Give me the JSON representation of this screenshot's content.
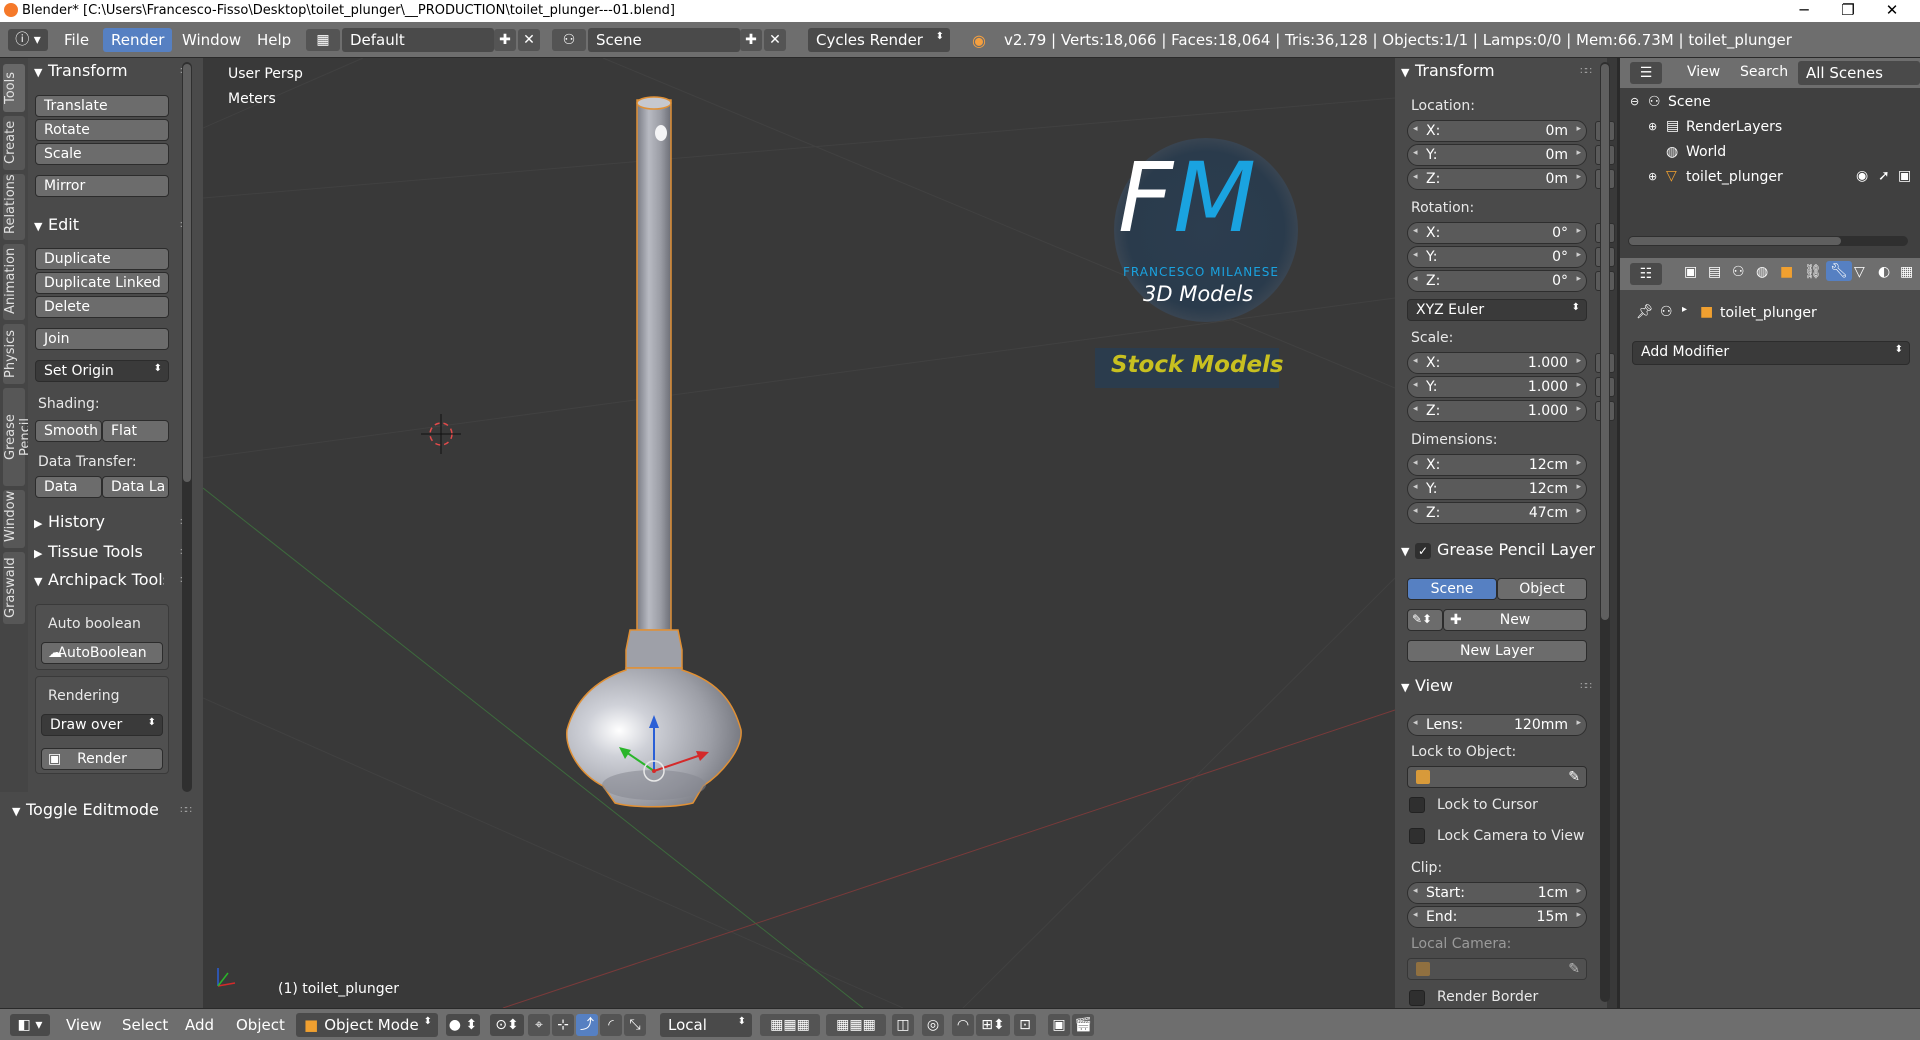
{
  "window": {
    "title": "Blender* [C:\\Users\\Francesco-Fisso\\Desktop\\toilet_plunger\\__PRODUCTION\\toilet_plunger---01.blend]",
    "controls": {
      "minimize": "─",
      "restore": "❐",
      "close": "✕"
    }
  },
  "topbar": {
    "menus": [
      "File",
      "Render",
      "Window",
      "Help"
    ],
    "active_menu": "Render",
    "layout": "Default",
    "scene": "Scene",
    "engine": "Cycles Render",
    "stats": "v2.79 | Verts:18,066 | Faces:18,064 | Tris:36,128 | Objects:1/1 | Lamps:0/0 | Mem:66.73M | toilet_plunger"
  },
  "tool_tabs": [
    "Tools",
    "Create",
    "Relations",
    "Animation",
    "Physics",
    "Grease Pencil",
    "Window",
    "Graswald"
  ],
  "toolshelf": {
    "transform": {
      "title": "Transform",
      "buttons": [
        "Translate",
        "Rotate",
        "Scale",
        "Mirror"
      ]
    },
    "edit": {
      "title": "Edit",
      "buttons": [
        "Duplicate",
        "Duplicate Linked",
        "Delete",
        "Join"
      ],
      "set_origin": "Set Origin",
      "shading_label": "Shading:",
      "smooth": "Smooth",
      "flat": "Flat",
      "data_transfer_label": "Data Transfer:",
      "data": "Data",
      "data_la": "Data La"
    },
    "history": "History",
    "tissue": "Tissue Tools",
    "archipack": {
      "title": "Archipack Tools",
      "auto_boolean": "Auto boolean",
      "auto_boolean_btn": "AutoBoolean",
      "rendering": "Rendering",
      "draw_over": "Draw over",
      "render": "Render"
    },
    "toggle_editmode": "Toggle Editmode"
  },
  "viewport": {
    "view_label": "User Persp",
    "units_label": "Meters",
    "object_label": "(1) toilet_plunger",
    "watermark": {
      "fm": "FM",
      "name": "FRANCESCO MILANESE",
      "models": "3D Models",
      "stock": "Stock Models"
    }
  },
  "npanel": {
    "transform_title": "Transform",
    "location_label": "Location:",
    "location": [
      {
        "axis": "X:",
        "value": "0m"
      },
      {
        "axis": "Y:",
        "value": "0m"
      },
      {
        "axis": "Z:",
        "value": "0m"
      }
    ],
    "rotation_label": "Rotation:",
    "rotation": [
      {
        "axis": "X:",
        "value": "0°"
      },
      {
        "axis": "Y:",
        "value": "0°"
      },
      {
        "axis": "Z:",
        "value": "0°"
      }
    ],
    "rotation_mode": "XYZ Euler",
    "scale_label": "Scale:",
    "scale": [
      {
        "axis": "X:",
        "value": "1.000"
      },
      {
        "axis": "Y:",
        "value": "1.000"
      },
      {
        "axis": "Z:",
        "value": "1.000"
      }
    ],
    "dimensions_label": "Dimensions:",
    "dimensions": [
      {
        "axis": "X:",
        "value": "12cm"
      },
      {
        "axis": "Y:",
        "value": "12cm"
      },
      {
        "axis": "Z:",
        "value": "47cm"
      }
    ],
    "grease_pencil_title": "Grease Pencil Layer",
    "gp_scene": "Scene",
    "gp_object": "Object",
    "gp_new": "New",
    "gp_new_layer": "New Layer",
    "view_title": "View",
    "lens_label": "Lens:",
    "lens_value": "120mm",
    "lock_to_object": "Lock to Object:",
    "lock_to_cursor": "Lock to Cursor",
    "lock_camera": "Lock Camera to View",
    "clip_label": "Clip:",
    "clip_start_label": "Start:",
    "clip_start": "1cm",
    "clip_end_label": "End:",
    "clip_end": "15m",
    "local_camera": "Local Camera:",
    "render_border": "Render Border"
  },
  "outliner": {
    "view": "View",
    "search": "Search",
    "filter": "All Scenes",
    "items": [
      "Scene",
      "RenderLayers",
      "World",
      "toilet_plunger"
    ]
  },
  "properties": {
    "object_name": "toilet_plunger",
    "add_modifier": "Add Modifier"
  },
  "bottombar": {
    "menus": [
      "View",
      "Select",
      "Add",
      "Object"
    ],
    "mode": "Object Mode",
    "pivot": "Local"
  },
  "colors": {
    "accent": "#5680c2",
    "object_outline": "#f0a030",
    "watermark_blue": "#1aa3e0",
    "watermark_yellow": "#c8c020"
  }
}
